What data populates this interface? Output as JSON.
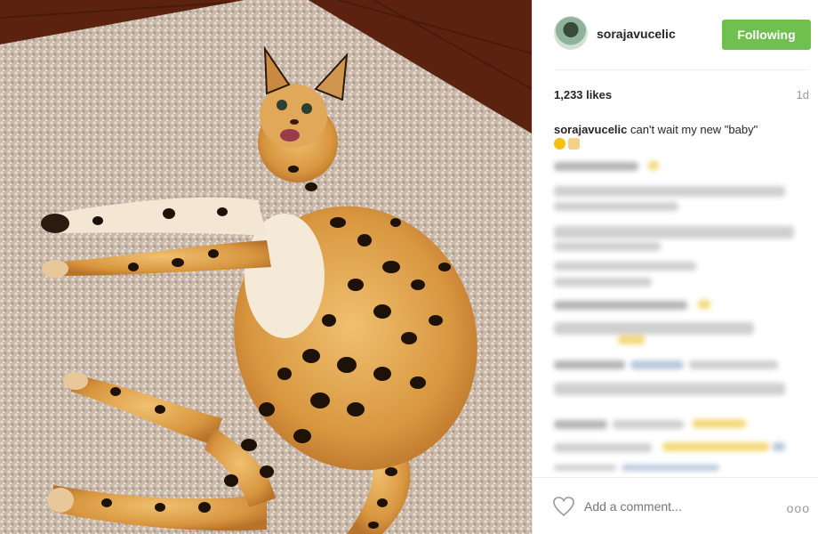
{
  "header": {
    "username": "sorajavucelic",
    "follow_label": "Following",
    "follow_color": "#70c050"
  },
  "post": {
    "likes": "1,233 likes",
    "time": "1d",
    "caption_user": "sorajavucelic",
    "caption_text": "can't wait my new \"baby\"",
    "caption_emojis": [
      "smiling-face-emoji",
      "hand-emoji"
    ]
  },
  "comments_blurred": true,
  "footer": {
    "comment_placeholder": "Add a comment...",
    "heart_icon": "heart-outline-icon",
    "more_icon": "more-options-icon",
    "more_glyph": "ooo"
  },
  "photo": {
    "subject": "serval-cat-on-shag-rug",
    "rug_color": "#c8b8a8",
    "floor_color": "#6a2a12",
    "fur_color": "#d99a45",
    "spot_color": "#1e1208"
  }
}
